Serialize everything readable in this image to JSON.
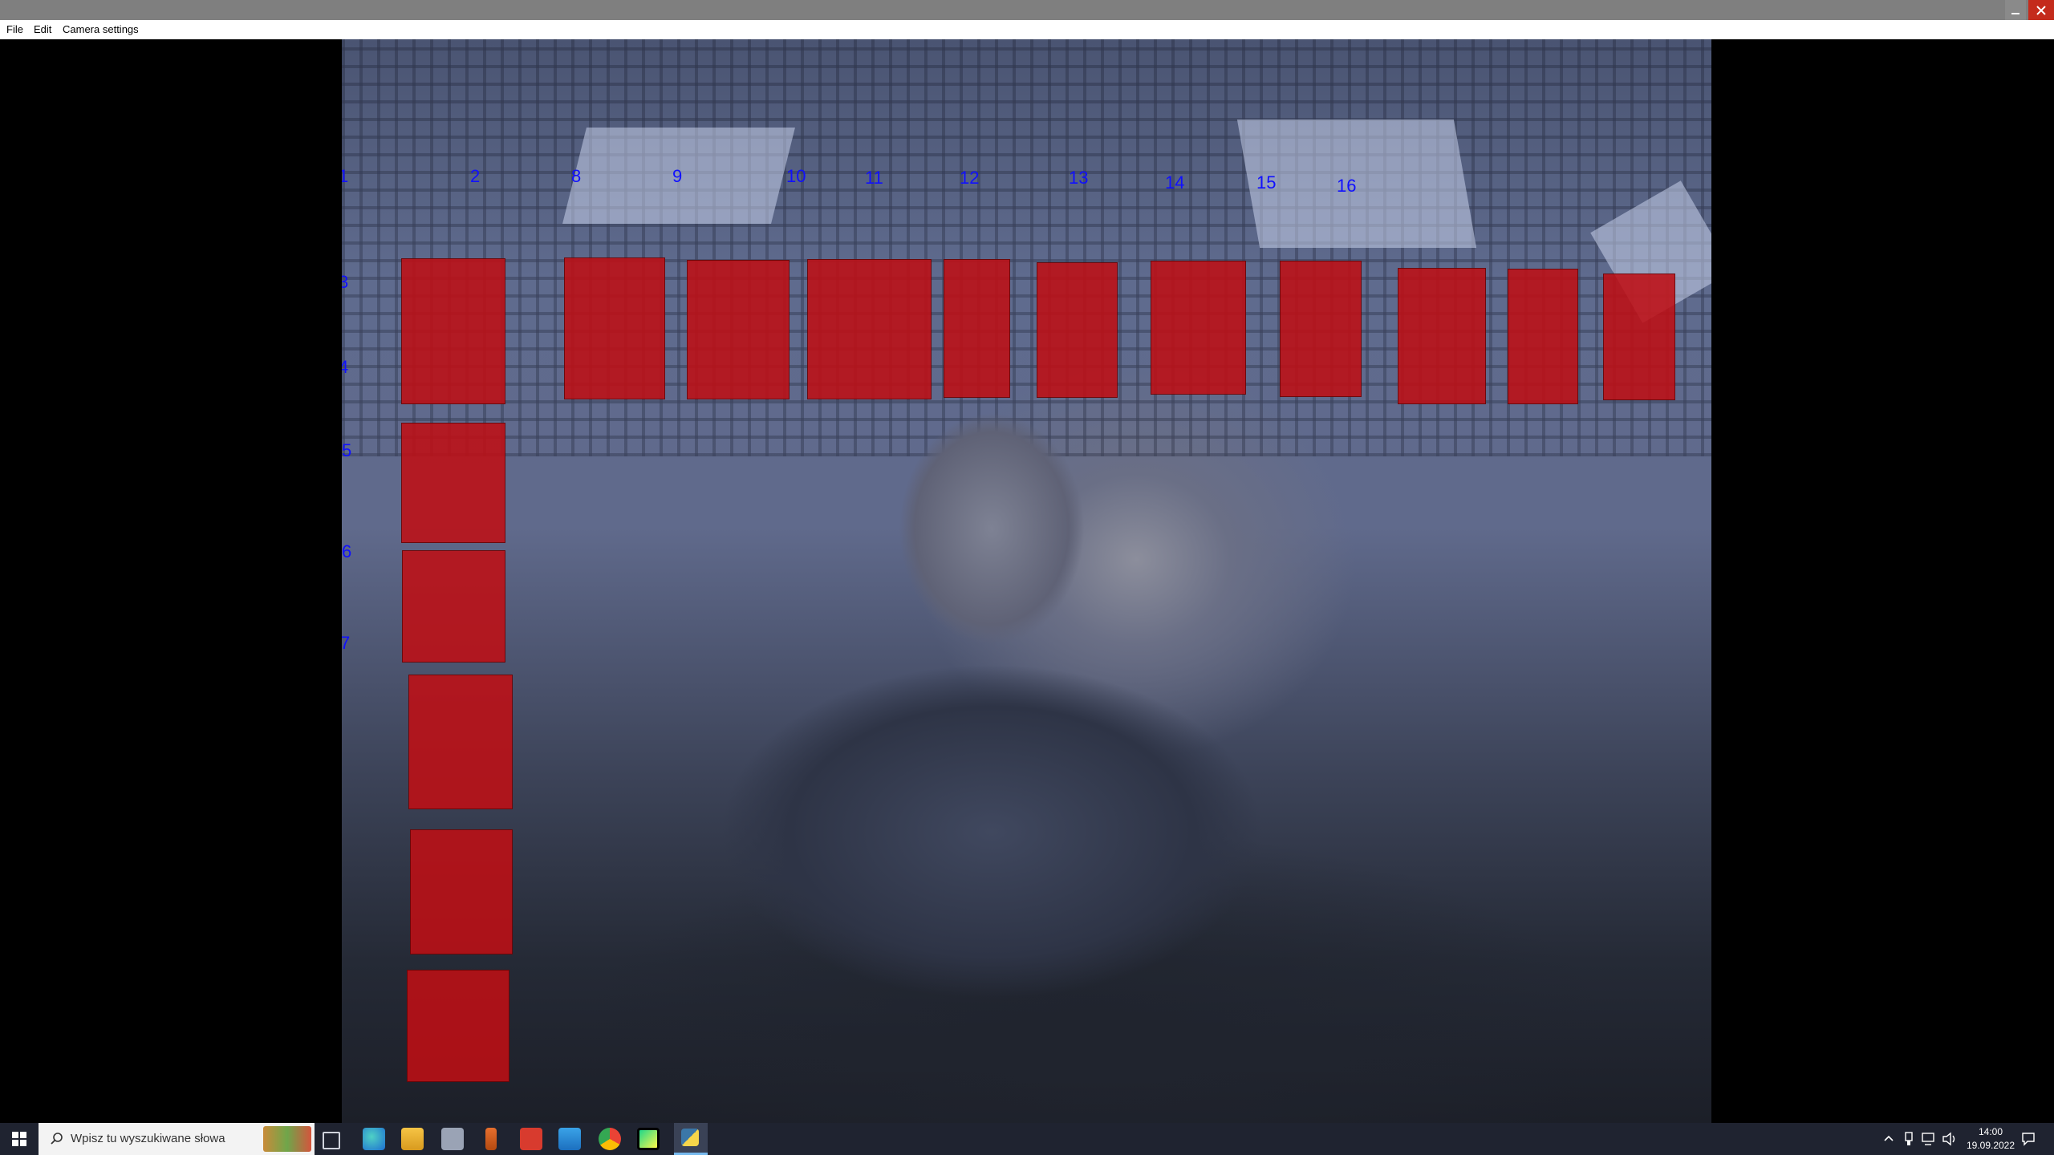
{
  "menu": {
    "items": [
      "File",
      "Edit",
      "Camera settings"
    ]
  },
  "window_controls": {
    "minimize_icon": "minimize-icon",
    "close_icon": "close-icon",
    "close_color": "#c42b1c"
  },
  "camera": {
    "zone_color": "#be0f14",
    "label_color": "#1010ff",
    "labels": [
      "1",
      "2",
      "8",
      "9",
      "10",
      "11",
      "12",
      "13",
      "14",
      "15",
      "16",
      "3",
      "4",
      "5",
      "6",
      "7"
    ],
    "zones_count_note": ""
  },
  "taskbar": {
    "search_placeholder": "Wpisz tu wyszukiwane słowa",
    "time": "14:00",
    "date": "19.09.2022",
    "pinned_icons": [
      "task-view-icon",
      "edge-icon",
      "file-explorer-icon",
      "app-icon",
      "java-icon",
      "app-red-icon",
      "store-icon",
      "chrome-icon",
      "pycharm-icon",
      "python-app-icon"
    ],
    "tray_icons": [
      "chevron-up-icon",
      "usb-icon",
      "network-icon",
      "volume-icon"
    ]
  }
}
